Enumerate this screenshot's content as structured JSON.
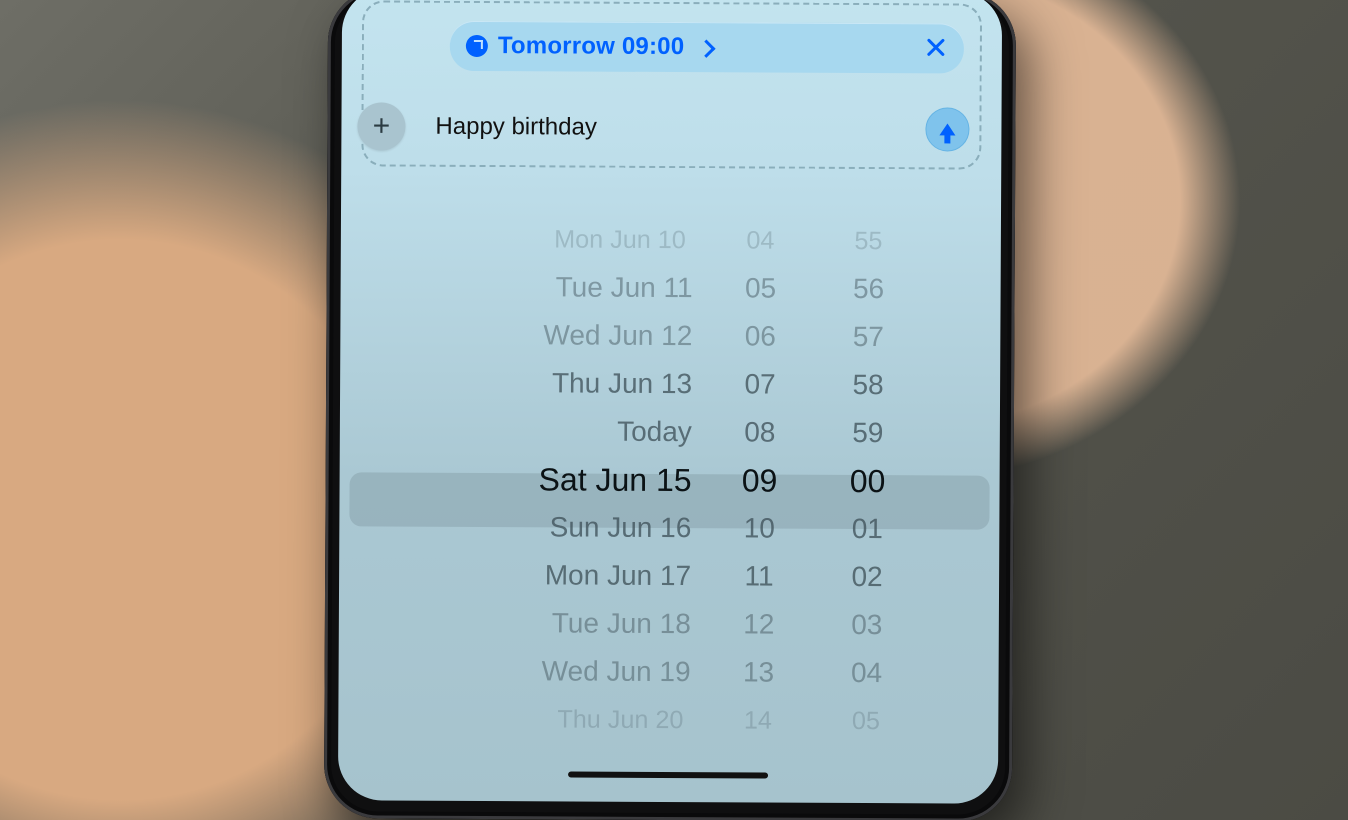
{
  "schedule_chip": {
    "label": "Tomorrow 09:00"
  },
  "message": {
    "text": "Happy birthday"
  },
  "picker": {
    "dates": {
      "minus5": "Mon Jun 10",
      "minus4": "Tue Jun 11",
      "minus3": "Wed Jun 12",
      "minus2": "Thu Jun 13",
      "minus1": "Today",
      "selected": "Sat Jun 15",
      "plus1": "Sun Jun 16",
      "plus2": "Mon Jun 17",
      "plus3": "Tue Jun 18",
      "plus4": "Wed Jun 19",
      "plus5": "Thu Jun 20"
    },
    "hours": {
      "minus5": "04",
      "minus4": "05",
      "minus3": "06",
      "minus2": "07",
      "minus1": "08",
      "selected": "09",
      "plus1": "10",
      "plus2": "11",
      "plus3": "12",
      "plus4": "13",
      "plus5": "14"
    },
    "minutes": {
      "minus5": "55",
      "minus4": "56",
      "minus3": "57",
      "minus2": "58",
      "minus1": "59",
      "selected": "00",
      "plus1": "01",
      "plus2": "02",
      "plus3": "03",
      "plus4": "04",
      "plus5": "05"
    }
  }
}
